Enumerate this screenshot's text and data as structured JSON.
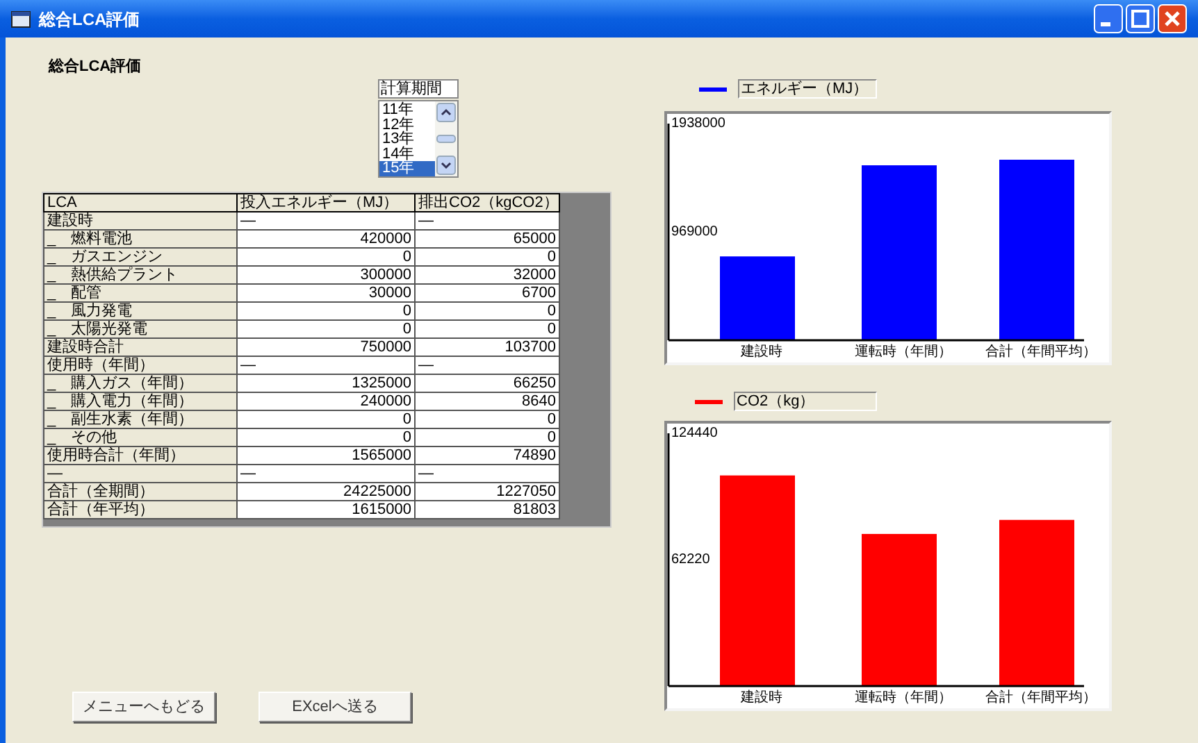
{
  "window": {
    "title": "総合LCA評価"
  },
  "heading": "総合LCA評価",
  "period": {
    "label": "計算期間",
    "items": [
      {
        "label": "11年",
        "selected": false
      },
      {
        "label": "12年",
        "selected": false
      },
      {
        "label": "13年",
        "selected": false
      },
      {
        "label": "14年",
        "selected": false
      },
      {
        "label": "15年",
        "selected": true
      }
    ]
  },
  "table": {
    "columns": [
      "LCA",
      "投入エネルギー（MJ）",
      "排出CO2（kgCO2）"
    ],
    "rows": [
      {
        "kind": "section",
        "cells": [
          "建設時",
          "—",
          "—"
        ]
      },
      {
        "kind": "item",
        "cells": [
          "_　燃料電池",
          "420000",
          "65000"
        ]
      },
      {
        "kind": "item",
        "cells": [
          "_　ガスエンジン",
          "0",
          "0"
        ]
      },
      {
        "kind": "item",
        "cells": [
          "_　熱供給プラント",
          "300000",
          "32000"
        ]
      },
      {
        "kind": "item",
        "cells": [
          "_　配管",
          "30000",
          "6700"
        ]
      },
      {
        "kind": "item",
        "cells": [
          "_　風力発電",
          "0",
          "0"
        ]
      },
      {
        "kind": "item",
        "cells": [
          "_　太陽光発電",
          "0",
          "0"
        ]
      },
      {
        "kind": "item",
        "cells": [
          "建設時合計",
          "750000",
          "103700"
        ]
      },
      {
        "kind": "section",
        "cells": [
          "使用時（年間）",
          "—",
          "—"
        ]
      },
      {
        "kind": "item",
        "cells": [
          "_　購入ガス（年間）",
          "1325000",
          "66250"
        ]
      },
      {
        "kind": "item",
        "cells": [
          "_　購入電力（年間）",
          "240000",
          "8640"
        ]
      },
      {
        "kind": "item",
        "cells": [
          "_　副生水素（年間）",
          "0",
          "0"
        ]
      },
      {
        "kind": "item",
        "cells": [
          "_　その他",
          "0",
          "0"
        ]
      },
      {
        "kind": "item",
        "cells": [
          "使用時合計（年間）",
          "1565000",
          "74890"
        ]
      },
      {
        "kind": "section",
        "cells": [
          "—",
          "—",
          "—"
        ]
      },
      {
        "kind": "item",
        "cells": [
          "合計（全期間）",
          "24225000",
          "1227050"
        ]
      },
      {
        "kind": "item",
        "cells": [
          "合計（年平均）",
          "1615000",
          "81803"
        ]
      }
    ]
  },
  "charts": [
    {
      "chart_data": {
        "type": "bar",
        "categories": [
          "建設時",
          "運転時（年間）",
          "合計（年間平均）"
        ],
        "series": [
          {
            "name": "エネルギー（MJ）",
            "color": "#0000ff",
            "values": [
              750000,
              1565000,
              1615000
            ]
          }
        ],
        "ylim": [
          0,
          1938000
        ],
        "yticks": [
          969000,
          1938000
        ]
      }
    },
    {
      "chart_data": {
        "type": "bar",
        "categories": [
          "建設時",
          "運転時（年間）",
          "合計（年間平均）"
        ],
        "series": [
          {
            "name": "CO2（kg）",
            "color": "#ff0000",
            "values": [
              103700,
              74890,
              81803
            ]
          }
        ],
        "ylim": [
          0,
          124440
        ],
        "yticks": [
          62220,
          124440
        ]
      }
    }
  ],
  "buttons": [
    "メニューへもどる",
    "EXcelへ送る"
  ]
}
